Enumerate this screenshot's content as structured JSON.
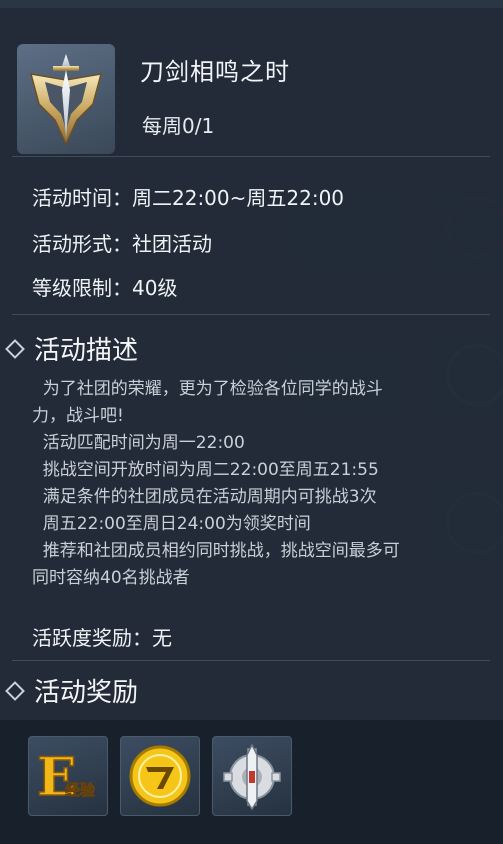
{
  "header": {
    "title": "刀剑相鸣之时",
    "weekly_count": "每周0/1"
  },
  "info": {
    "time": "活动时间：周二22:00~周五22:00",
    "format": "活动形式：社团活动",
    "level": "等级限制：40级"
  },
  "description": {
    "heading": "活动描述",
    "lines": [
      "  为了社团的荣耀，更为了检验各位同学的战斗",
      "力，战斗吧!",
      "  活动匹配时间为周一22:00",
      "  挑战空间开放时间为周二22:00至周五21:55",
      "  满足条件的社团成员在活动周期内可挑战3次",
      "  周五22:00至周日24:00为领奖时间",
      "  推荐和社团成员相约同时挑战，挑战空间最多可",
      "同时容纳40名挑战者"
    ],
    "activity_reward": "活跃度奖励：无"
  },
  "rewards": {
    "heading": "活动奖励",
    "items": [
      {
        "name": "exp-item",
        "label": "经验"
      },
      {
        "name": "coin-item"
      },
      {
        "name": "gear-blade-item"
      }
    ]
  }
}
